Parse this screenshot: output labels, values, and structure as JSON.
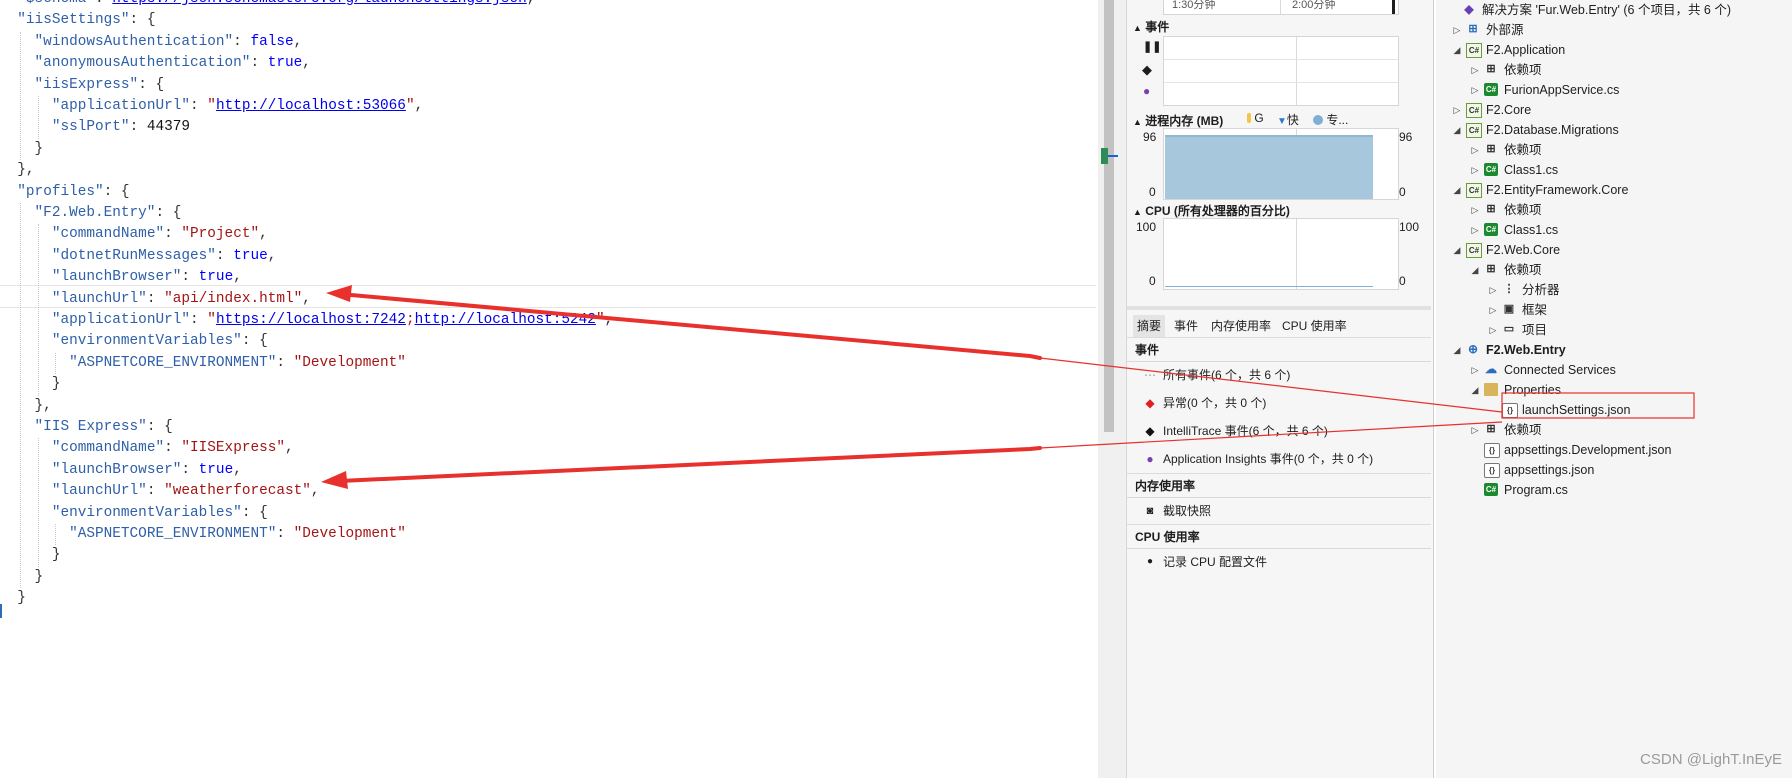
{
  "editor": {
    "lines": [
      [
        [
          "pn",
          "  "
        ],
        [
          "k",
          "\"$schema\""
        ],
        [
          "pn",
          ": "
        ],
        [
          "u",
          "https://json.schemastore.org/launchsettings.json"
        ],
        [
          "pn",
          ","
        ]
      ],
      [
        [
          "pn",
          "  "
        ],
        [
          "k",
          "\"iisSettings\""
        ],
        [
          "pn",
          ": {"
        ]
      ],
      [
        [
          "pn",
          "    "
        ],
        [
          "k",
          "\"windowsAuthentication\""
        ],
        [
          "pn",
          ": "
        ],
        [
          "b",
          "false"
        ],
        [
          "pn",
          ","
        ]
      ],
      [
        [
          "pn",
          "    "
        ],
        [
          "k",
          "\"anonymousAuthentication\""
        ],
        [
          "pn",
          ": "
        ],
        [
          "b",
          "true"
        ],
        [
          "pn",
          ","
        ]
      ],
      [
        [
          "pn",
          "    "
        ],
        [
          "k",
          "\"iisExpress\""
        ],
        [
          "pn",
          ": {"
        ]
      ],
      [
        [
          "pn",
          "      "
        ],
        [
          "k",
          "\"applicationUrl\""
        ],
        [
          "pn",
          ": "
        ],
        [
          "s",
          "\""
        ],
        [
          "u",
          "http://localhost:53066"
        ],
        [
          "s",
          "\""
        ],
        [
          "pn",
          ","
        ]
      ],
      [
        [
          "pn",
          "      "
        ],
        [
          "k",
          "\"sslPort\""
        ],
        [
          "pn",
          ": "
        ],
        [
          "n2",
          "44379"
        ]
      ],
      [
        [
          "pn",
          "    }"
        ]
      ],
      [
        [
          "pn",
          "  },"
        ]
      ],
      [
        [
          "pn",
          "  "
        ],
        [
          "k",
          "\"profiles\""
        ],
        [
          "pn",
          ": {"
        ]
      ],
      [
        [
          "pn",
          "    "
        ],
        [
          "k",
          "\"F2.Web.Entry\""
        ],
        [
          "pn",
          ": {"
        ]
      ],
      [
        [
          "pn",
          "      "
        ],
        [
          "k",
          "\"commandName\""
        ],
        [
          "pn",
          ": "
        ],
        [
          "s",
          "\"Project\""
        ],
        [
          "pn",
          ","
        ]
      ],
      [
        [
          "pn",
          "      "
        ],
        [
          "k",
          "\"dotnetRunMessages\""
        ],
        [
          "pn",
          ": "
        ],
        [
          "b",
          "true"
        ],
        [
          "pn",
          ","
        ]
      ],
      [
        [
          "pn",
          "      "
        ],
        [
          "k",
          "\"launchBrowser\""
        ],
        [
          "pn",
          ": "
        ],
        [
          "b",
          "true"
        ],
        [
          "pn",
          ","
        ]
      ],
      [
        [
          "pn",
          "      "
        ],
        [
          "k",
          "\"launchUrl\""
        ],
        [
          "pn",
          ": "
        ],
        [
          "s",
          "\"api/index.html\""
        ],
        [
          "pn",
          ","
        ]
      ],
      [
        [
          "pn",
          "      "
        ],
        [
          "k",
          "\"applicationUrl\""
        ],
        [
          "pn",
          ": "
        ],
        [
          "s",
          "\""
        ],
        [
          "u",
          "https://localhost:7242"
        ],
        [
          "s",
          ";"
        ],
        [
          "u",
          "http://localhost:5242"
        ],
        [
          "s",
          "\""
        ],
        [
          "pn",
          ","
        ]
      ],
      [
        [
          "pn",
          "      "
        ],
        [
          "k",
          "\"environmentVariables\""
        ],
        [
          "pn",
          ": {"
        ]
      ],
      [
        [
          "pn",
          "        "
        ],
        [
          "k",
          "\"ASPNETCORE_ENVIRONMENT\""
        ],
        [
          "pn",
          ": "
        ],
        [
          "s",
          "\"Development\""
        ]
      ],
      [
        [
          "pn",
          "      }"
        ]
      ],
      [
        [
          "pn",
          "    },"
        ]
      ],
      [
        [
          "pn",
          "    "
        ],
        [
          "k",
          "\"IIS Express\""
        ],
        [
          "pn",
          ": {"
        ]
      ],
      [
        [
          "pn",
          "      "
        ],
        [
          "k",
          "\"commandName\""
        ],
        [
          "pn",
          ": "
        ],
        [
          "s",
          "\"IISExpress\""
        ],
        [
          "pn",
          ","
        ]
      ],
      [
        [
          "pn",
          "      "
        ],
        [
          "k",
          "\"launchBrowser\""
        ],
        [
          "pn",
          ": "
        ],
        [
          "b",
          "true"
        ],
        [
          "pn",
          ","
        ]
      ],
      [
        [
          "pn",
          "      "
        ],
        [
          "k",
          "\"launchUrl\""
        ],
        [
          "pn",
          ": "
        ],
        [
          "s",
          "\"weatherforecast\""
        ],
        [
          "pn",
          ","
        ]
      ],
      [
        [
          "pn",
          "      "
        ],
        [
          "k",
          "\"environmentVariables\""
        ],
        [
          "pn",
          ": {"
        ]
      ],
      [
        [
          "pn",
          "        "
        ],
        [
          "k",
          "\"ASPNETCORE_ENVIRONMENT\""
        ],
        [
          "pn",
          ": "
        ],
        [
          "s",
          "\"Development\""
        ]
      ],
      [
        [
          "pn",
          "      }"
        ]
      ],
      [
        [
          "pn",
          "    }"
        ]
      ],
      [
        [
          "pn",
          "  }"
        ]
      ]
    ]
  },
  "diagnostics": {
    "timeline_labels": [
      "1:30分钟",
      "2:00分钟"
    ],
    "events_title": "事件",
    "memory_title": "进程内存 (MB)",
    "memory_legend": [
      {
        "icon": "gc-icon",
        "text": "G",
        "color": "#f2c744"
      },
      {
        "icon": "snapshot-icon",
        "text": "快",
        "color": "#2b7bd6"
      },
      {
        "icon": "private-bytes-icon",
        "text": "专...",
        "color": "#7fb0d3"
      }
    ],
    "memory_max": "96",
    "memory_min": "0",
    "memory_value_mb": 96,
    "cpu_title": "CPU (所有处理器的百分比)",
    "cpu_max": "100",
    "cpu_min": "0",
    "cpu_value_percent": 0,
    "tabs": [
      "摘要",
      "事件",
      "内存使用率",
      "CPU 使用率"
    ],
    "active_tab": 0,
    "events_section": "事件",
    "event_rows": [
      {
        "icon": "all-events-icon",
        "text": "所有事件(6 个，共 6 个)",
        "color": "#888888"
      },
      {
        "icon": "exception-icon",
        "text": "异常(0 个，共 0 个)",
        "color": "#e02020"
      },
      {
        "icon": "intellitrace-icon",
        "text": "IntelliTrace 事件(6 个，共 6 个)",
        "color": "#111111"
      },
      {
        "icon": "app-insights-icon",
        "text": "Application Insights 事件(0 个，共 0 个)",
        "color": "#7a3fb0"
      }
    ],
    "memory_section": "内存使用率",
    "memory_action": "截取快照",
    "cpu_section": "CPU 使用率",
    "cpu_action": "记录 CPU 配置文件"
  },
  "solution": {
    "nodes": [
      {
        "name": "solution-node",
        "label": "解决方案 'Fur.Web.Entry' (6 个项目，共 6 个)",
        "icon": "solution-icon",
        "glyph": "◆",
        "cls": "sln",
        "expander": "",
        "level": 0
      },
      {
        "name": "external-sources-node",
        "label": "外部源",
        "icon": "external-sources-icon",
        "glyph": "⊞",
        "cls": "ext",
        "expander": "▷",
        "level": 0
      },
      {
        "name": "f2-application-node",
        "label": "F2.Application",
        "icon": "csproj-icon",
        "glyph": "C#",
        "cls": "csproj",
        "expander": "◢",
        "level": 0
      },
      {
        "name": "dependencies-node",
        "label": "依赖项",
        "icon": "dependencies-icon",
        "glyph": "⊞",
        "cls": "dep",
        "expander": "▷",
        "level": 1
      },
      {
        "name": "cs-file-node",
        "label": "FurionAppService.cs",
        "icon": "csharp-file-icon",
        "glyph": "C#",
        "cls": "cs",
        "expander": "▷",
        "level": 1
      },
      {
        "name": "f2-core-node",
        "label": "F2.Core",
        "icon": "csproj-icon",
        "glyph": "C#",
        "cls": "csproj",
        "expander": "▷",
        "level": 0
      },
      {
        "name": "f2-database-migrations-node",
        "label": "F2.Database.Migrations",
        "icon": "csproj-icon",
        "glyph": "C#",
        "cls": "csproj",
        "expander": "◢",
        "level": 0
      },
      {
        "name": "dependencies-node",
        "label": "依赖项",
        "icon": "dependencies-icon",
        "glyph": "⊞",
        "cls": "dep",
        "expander": "▷",
        "level": 1
      },
      {
        "name": "cs-file-node",
        "label": "Class1.cs",
        "icon": "csharp-file-icon",
        "glyph": "C#",
        "cls": "cs",
        "expander": "▷",
        "level": 1
      },
      {
        "name": "f2-entityframework-core-node",
        "label": "F2.EntityFramework.Core",
        "icon": "csproj-icon",
        "glyph": "C#",
        "cls": "csproj",
        "expander": "◢",
        "level": 0
      },
      {
        "name": "dependencies-node",
        "label": "依赖项",
        "icon": "dependencies-icon",
        "glyph": "⊞",
        "cls": "dep",
        "expander": "▷",
        "level": 1
      },
      {
        "name": "cs-file-node",
        "label": "Class1.cs",
        "icon": "csharp-file-icon",
        "glyph": "C#",
        "cls": "cs",
        "expander": "▷",
        "level": 1
      },
      {
        "name": "f2-web-core-node",
        "label": "F2.Web.Core",
        "icon": "csproj-icon",
        "glyph": "C#",
        "cls": "csproj",
        "expander": "◢",
        "level": 0
      },
      {
        "name": "dependencies-node",
        "label": "依赖项",
        "icon": "dependencies-icon",
        "glyph": "⊞",
        "cls": "dep",
        "expander": "◢",
        "level": 1
      },
      {
        "name": "analyzers-node",
        "label": "分析器",
        "icon": "analyzer-icon",
        "glyph": "⋮",
        "cls": "dep",
        "expander": "▷",
        "level": 2
      },
      {
        "name": "frameworks-node",
        "label": "框架",
        "icon": "framework-icon",
        "glyph": "▣",
        "cls": "dep",
        "expander": "▷",
        "level": 2
      },
      {
        "name": "projects-node",
        "label": "项目",
        "icon": "project-ref-icon",
        "glyph": "▭",
        "cls": "dep",
        "expander": "▷",
        "level": 2
      },
      {
        "name": "f2-web-entry-node",
        "label": "F2.Web.Entry",
        "icon": "web-project-icon",
        "glyph": "⊕",
        "cls": "web",
        "expander": "◢",
        "level": 0,
        "bold": true
      },
      {
        "name": "connected-services-node",
        "label": "Connected Services",
        "icon": "connected-services-icon",
        "glyph": "☁",
        "cls": "conn",
        "expander": "▷",
        "level": 1
      },
      {
        "name": "properties-node",
        "label": "Properties",
        "icon": "properties-folder-icon",
        "glyph": "",
        "cls": "folder",
        "expander": "◢",
        "level": 1
      },
      {
        "name": "launchsettings-json-node",
        "label": "launchSettings.json",
        "icon": "json-file-icon",
        "glyph": "{}",
        "cls": "json",
        "expander": "",
        "level": 2,
        "selected": true
      },
      {
        "name": "dependencies-node",
        "label": "依赖项",
        "icon": "dependencies-icon",
        "glyph": "⊞",
        "cls": "dep",
        "expander": "▷",
        "level": 1
      },
      {
        "name": "appsettings-development-json-node",
        "label": "appsettings.Development.json",
        "icon": "json-file-icon",
        "glyph": "{}",
        "cls": "json",
        "expander": "",
        "level": 1
      },
      {
        "name": "appsettings-json-node",
        "label": "appsettings.json",
        "icon": "json-file-icon",
        "glyph": "{}",
        "cls": "json",
        "expander": "",
        "level": 1
      },
      {
        "name": "program-cs-node",
        "label": "Program.cs",
        "icon": "csharp-file-icon",
        "glyph": "C#",
        "cls": "cs",
        "expander": "",
        "level": 1
      }
    ]
  },
  "annotation_color": "#e8302c",
  "watermark": "CSDN @LighT.InEyE"
}
